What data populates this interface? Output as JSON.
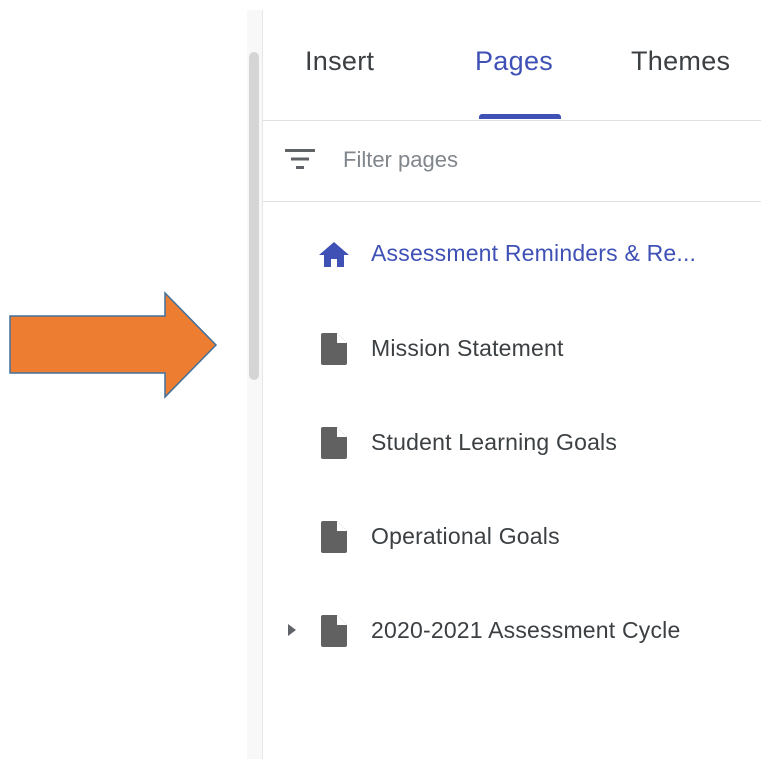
{
  "tabs": [
    {
      "label": "Insert",
      "selected": false
    },
    {
      "label": "Pages",
      "selected": true
    },
    {
      "label": "Themes",
      "selected": false
    }
  ],
  "filter": {
    "placeholder": "Filter pages",
    "value": "",
    "icon": "filter-icon"
  },
  "pages": [
    {
      "label": "Assessment Reminders & Re...",
      "icon": "home-icon",
      "home": true,
      "expandable": false
    },
    {
      "label": "Mission Statement",
      "icon": "page-icon",
      "home": false,
      "expandable": false
    },
    {
      "label": "Student Learning Goals",
      "icon": "page-icon",
      "home": false,
      "expandable": false
    },
    {
      "label": "Operational Goals",
      "icon": "page-icon",
      "home": false,
      "expandable": false
    },
    {
      "label": "2020-2021 Assessment Cycle",
      "icon": "page-icon",
      "home": false,
      "expandable": true
    }
  ],
  "colors": {
    "accent": "#3f51b5",
    "text": "#3c4043",
    "icon_gray": "#616161",
    "arrow_fill": "#ed7d31",
    "arrow_stroke": "#41719c"
  },
  "annotation": {
    "arrow_direction": "right"
  }
}
